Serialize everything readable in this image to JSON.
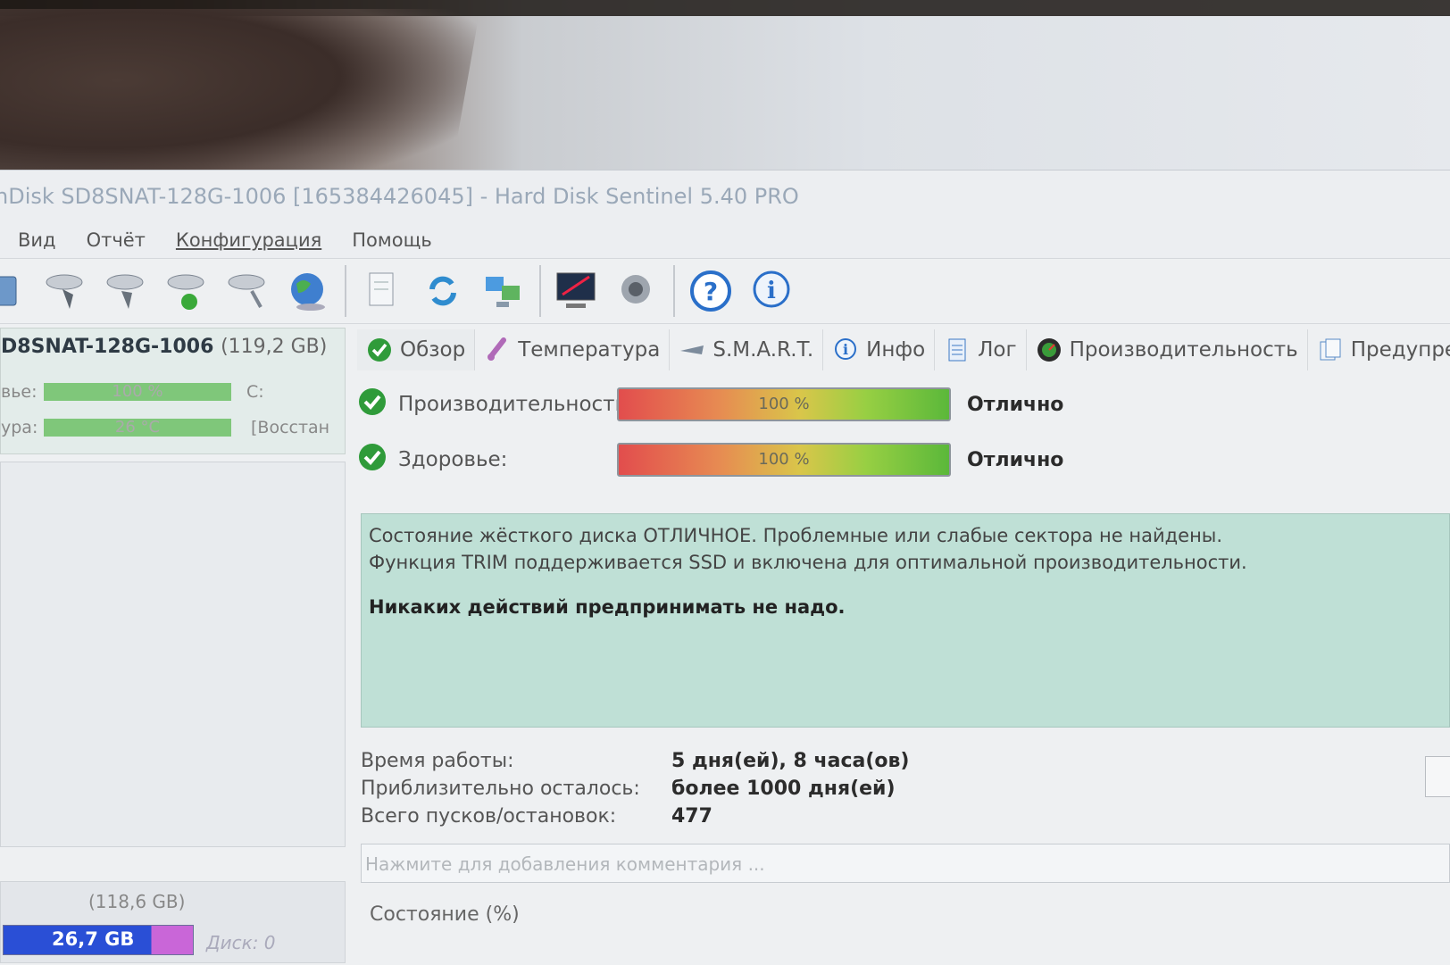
{
  "window": {
    "title": "nDisk SD8SNAT-128G-1006 [165384426045]  -  Hard Disk Sentinel 5.40 PRO"
  },
  "menu": {
    "items": [
      "Вид",
      "Отчёт",
      "Конфигурация",
      "Помощь"
    ]
  },
  "toolbar": {
    "icons": [
      "disk-icon",
      "disk-test-icon",
      "disk-surface-icon",
      "disk-ok-icon",
      "disk-tools-icon",
      "globe-icon",
      "document-icon",
      "refresh-icon",
      "network-icon",
      "monitor-icon",
      "speaker-icon",
      "help-icon",
      "info-icon"
    ]
  },
  "sidebar": {
    "disk": {
      "name": "D8SNAT-128G-1006",
      "size": "(119,2 GB)",
      "rows": [
        {
          "label": "вье:",
          "value": "100 %",
          "extra": "C:"
        },
        {
          "label": "ура:",
          "value": "26 °C",
          "extra": "[Восстан"
        }
      ]
    },
    "partition": {
      "size": "(118,6 GB)",
      "used": "26,7 GB",
      "disk_label": "Диск: 0",
      "used_fraction": 0.78
    }
  },
  "tabs": [
    {
      "label": "Обзор",
      "icon": "check-icon"
    },
    {
      "label": "Температура",
      "icon": "thermometer-icon"
    },
    {
      "label": "S.M.A.R.T.",
      "icon": "smart-icon"
    },
    {
      "label": "Инфо",
      "icon": "info-icon"
    },
    {
      "label": "Лог",
      "icon": "log-icon"
    },
    {
      "label": "Производительность",
      "icon": "gauge-icon"
    },
    {
      "label": "Предупре",
      "icon": "warning-doc-icon"
    }
  ],
  "overview": {
    "performance": {
      "label": "Производительность",
      "value": "100 %",
      "verdict": "Отлично",
      "percent": 100
    },
    "health": {
      "label": "Здоровье:",
      "value": "100 %",
      "verdict": "Отлично",
      "percent": 100
    },
    "message": {
      "line1": "Состояние жёсткого диска ОТЛИЧНОЕ. Проблемные или слабые сектора не найдены.",
      "line2": "Функция TRIM поддерживается SSD и включена для оптимальной производительности.",
      "action": "Никаких действий предпринимать не надо."
    },
    "stats": [
      {
        "key": "Время работы:",
        "value": "5 дня(ей), 8 часа(ов)"
      },
      {
        "key": "Приблизительно осталось:",
        "value": "более 1000 дня(ей)"
      },
      {
        "key": "Всего пусков/остановок:",
        "value": "477"
      }
    ],
    "comment_placeholder": "Нажмите для добавления комментария ...",
    "status_title": "Состояние (%)"
  },
  "colors": {
    "message_bg": "#bfe0d6",
    "partition_used": "#2a4fd6",
    "partition_free": "#c966d8"
  }
}
